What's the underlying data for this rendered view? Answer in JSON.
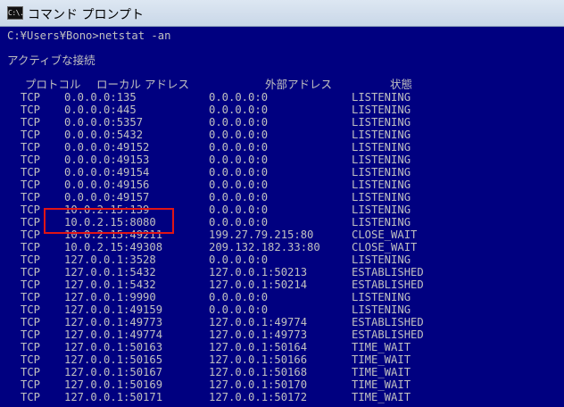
{
  "window": {
    "title": "コマンド プロンプト",
    "icon": "cmd-icon",
    "icon_label": "C:\\."
  },
  "console": {
    "command_line": "C:¥Users¥Bono>netstat -an",
    "section_title": "アクティブな接続",
    "columns": {
      "protocol": "プロトコル",
      "local": "ローカル アドレス",
      "foreign": "外部アドレス",
      "state": "状態"
    },
    "rows": [
      {
        "proto": "TCP",
        "local": "0.0.0.0:135",
        "foreign": "0.0.0.0:0",
        "state": "LISTENING"
      },
      {
        "proto": "TCP",
        "local": "0.0.0.0:445",
        "foreign": "0.0.0.0:0",
        "state": "LISTENING"
      },
      {
        "proto": "TCP",
        "local": "0.0.0.0:5357",
        "foreign": "0.0.0.0:0",
        "state": "LISTENING"
      },
      {
        "proto": "TCP",
        "local": "0.0.0.0:5432",
        "foreign": "0.0.0.0:0",
        "state": "LISTENING"
      },
      {
        "proto": "TCP",
        "local": "0.0.0.0:49152",
        "foreign": "0.0.0.0:0",
        "state": "LISTENING"
      },
      {
        "proto": "TCP",
        "local": "0.0.0.0:49153",
        "foreign": "0.0.0.0:0",
        "state": "LISTENING"
      },
      {
        "proto": "TCP",
        "local": "0.0.0.0:49154",
        "foreign": "0.0.0.0:0",
        "state": "LISTENING"
      },
      {
        "proto": "TCP",
        "local": "0.0.0.0:49156",
        "foreign": "0.0.0.0:0",
        "state": "LISTENING"
      },
      {
        "proto": "TCP",
        "local": "0.0.0.0:49157",
        "foreign": "0.0.0.0:0",
        "state": "LISTENING"
      },
      {
        "proto": "TCP",
        "local": "10.0.2.15:139",
        "foreign": "0.0.0.0:0",
        "state": "LISTENING"
      },
      {
        "proto": "TCP",
        "local": "10.0.2.15:8080",
        "foreign": "0.0.0.0:0",
        "state": "LISTENING"
      },
      {
        "proto": "TCP",
        "local": "10.0.2.15:49211",
        "foreign": "199.27.79.215:80",
        "state": "CLOSE_WAIT"
      },
      {
        "proto": "TCP",
        "local": "10.0.2.15:49308",
        "foreign": "209.132.182.33:80",
        "state": "CLOSE_WAIT"
      },
      {
        "proto": "TCP",
        "local": "127.0.0.1:3528",
        "foreign": "0.0.0.0:0",
        "state": "LISTENING"
      },
      {
        "proto": "TCP",
        "local": "127.0.0.1:5432",
        "foreign": "127.0.0.1:50213",
        "state": "ESTABLISHED"
      },
      {
        "proto": "TCP",
        "local": "127.0.0.1:5432",
        "foreign": "127.0.0.1:50214",
        "state": "ESTABLISHED"
      },
      {
        "proto": "TCP",
        "local": "127.0.0.1:9990",
        "foreign": "0.0.0.0:0",
        "state": "LISTENING"
      },
      {
        "proto": "TCP",
        "local": "127.0.0.1:49159",
        "foreign": "0.0.0.0:0",
        "state": "LISTENING"
      },
      {
        "proto": "TCP",
        "local": "127.0.0.1:49773",
        "foreign": "127.0.0.1:49774",
        "state": "ESTABLISHED"
      },
      {
        "proto": "TCP",
        "local": "127.0.0.1:49774",
        "foreign": "127.0.0.1:49773",
        "state": "ESTABLISHED"
      },
      {
        "proto": "TCP",
        "local": "127.0.0.1:50163",
        "foreign": "127.0.0.1:50164",
        "state": "TIME_WAIT"
      },
      {
        "proto": "TCP",
        "local": "127.0.0.1:50165",
        "foreign": "127.0.0.1:50166",
        "state": "TIME_WAIT"
      },
      {
        "proto": "TCP",
        "local": "127.0.0.1:50167",
        "foreign": "127.0.0.1:50168",
        "state": "TIME_WAIT"
      },
      {
        "proto": "TCP",
        "local": "127.0.0.1:50169",
        "foreign": "127.0.0.1:50170",
        "state": "TIME_WAIT"
      },
      {
        "proto": "TCP",
        "local": "127.0.0.1:50171",
        "foreign": "127.0.0.1:50172",
        "state": "TIME_WAIT"
      }
    ]
  },
  "colors": {
    "console_bg": "#000080",
    "console_fg": "#c0c0c0",
    "highlight": "#e01515"
  }
}
